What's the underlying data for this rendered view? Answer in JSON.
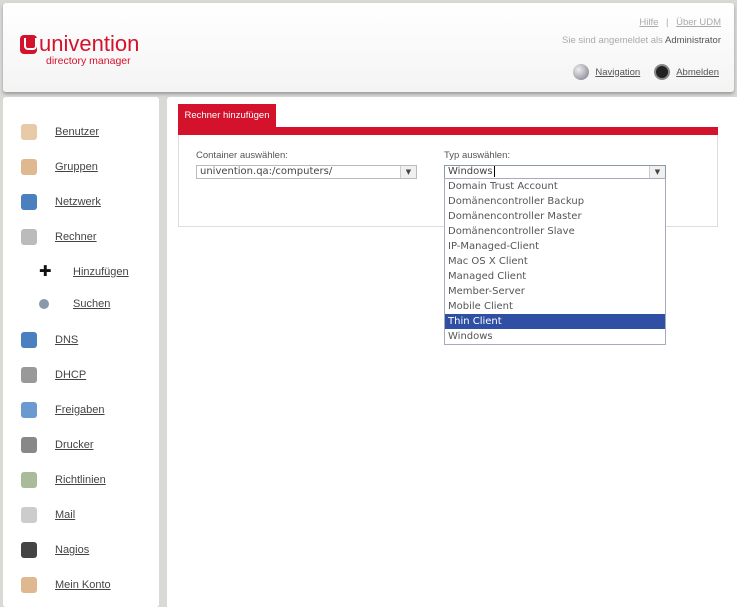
{
  "header": {
    "brand": "univention",
    "subtitle": "directory manager",
    "help": "Hilfe",
    "separator": "|",
    "about": "Über UDM",
    "login_prefix": "Sie sind angemeldet als",
    "user": "Administrator",
    "navigation": "Navigation",
    "logout": "Abmelden"
  },
  "sidebar": {
    "items": [
      {
        "label": "Benutzer",
        "icon": "user-icon",
        "color": "#e8c9a8"
      },
      {
        "label": "Gruppen",
        "icon": "group-icon",
        "color": "#e0b890"
      },
      {
        "label": "Netzwerk",
        "icon": "globe-icon",
        "color": "#4a7fc0"
      },
      {
        "label": "Rechner",
        "icon": "computer-icon",
        "color": "#bbbbbb"
      },
      {
        "label": "Hinzufügen",
        "icon": "plus-icon",
        "color": "#111111"
      },
      {
        "label": "Suchen",
        "icon": "magnifier-icon",
        "color": "#8899aa"
      },
      {
        "label": "DNS",
        "icon": "dns-globe-icon",
        "color": "#4a7fc0"
      },
      {
        "label": "DHCP",
        "icon": "dhcp-icon",
        "color": "#999999"
      },
      {
        "label": "Freigaben",
        "icon": "share-icon",
        "color": "#6a9ad0"
      },
      {
        "label": "Drucker",
        "icon": "printer-icon",
        "color": "#888888"
      },
      {
        "label": "Richtlinien",
        "icon": "policy-icon",
        "color": "#aabb99"
      },
      {
        "label": "Mail",
        "icon": "mail-icon",
        "color": "#cccccc"
      },
      {
        "label": "Nagios",
        "icon": "monitor-icon",
        "color": "#444444"
      },
      {
        "label": "Mein Konto",
        "icon": "account-icon",
        "color": "#e0b890"
      }
    ]
  },
  "main": {
    "tab": "Rechner hinzufügen",
    "container_label": "Container auswählen:",
    "container_value": "univention.qa:/computers/",
    "type_label": "Typ auswählen:",
    "type_value": "Windows",
    "options": [
      "Domain Trust Account",
      "Domänencontroller Backup",
      "Domänencontroller Master",
      "Domänencontroller Slave",
      "IP-Managed-Client",
      "Mac OS X Client",
      "Managed Client",
      "Member-Server",
      "Mobile Client",
      "Thin Client",
      "Windows"
    ],
    "highlighted": "Thin Client"
  }
}
